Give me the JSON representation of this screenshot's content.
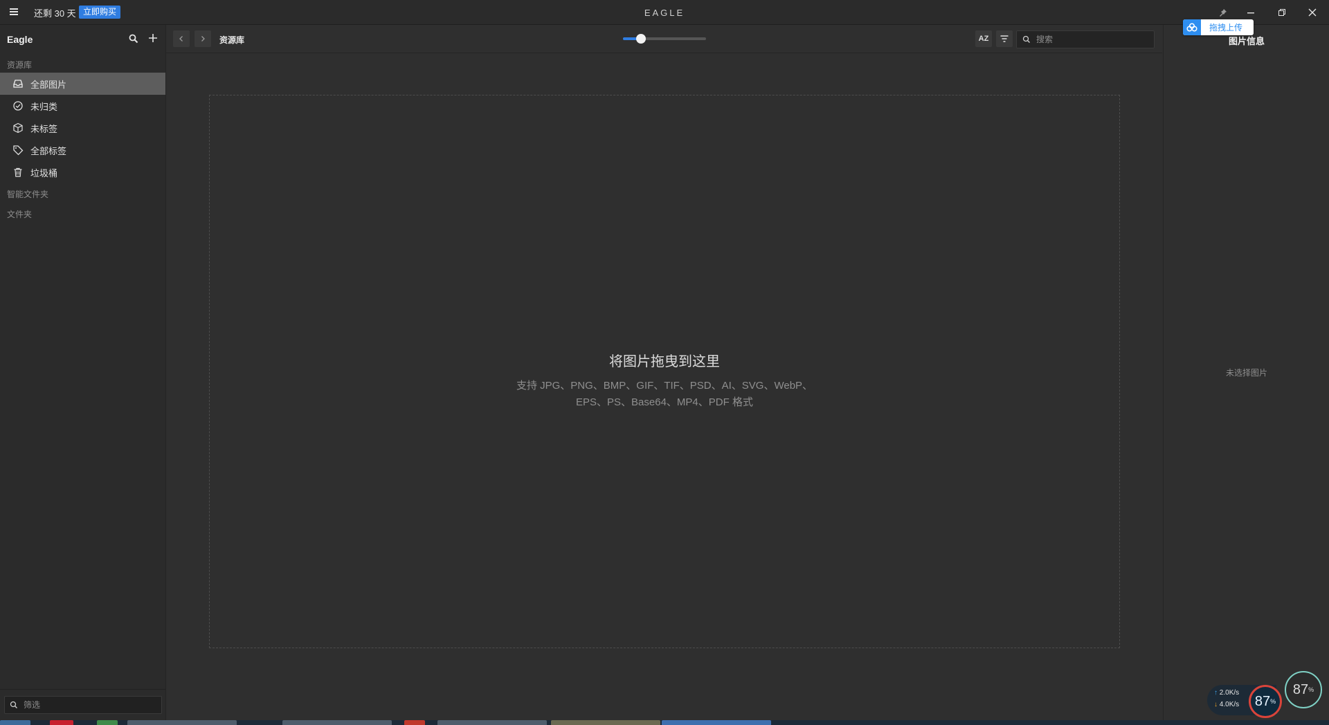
{
  "titlebar": {
    "trial_text": "还剩 30 天",
    "buy_label": "立即购买",
    "app_name": "EAGLE"
  },
  "upload_widget": {
    "label": "拖拽上传"
  },
  "sidebar": {
    "title": "Eagle",
    "section_library": "资源库",
    "items": [
      {
        "label": "全部图片",
        "icon": "inbox-icon"
      },
      {
        "label": "未归类",
        "icon": "check-circle-icon"
      },
      {
        "label": "未标签",
        "icon": "box-icon"
      },
      {
        "label": "全部标签",
        "icon": "tag-icon"
      },
      {
        "label": "垃圾桶",
        "icon": "trash-icon"
      }
    ],
    "section_smart": "智能文件夹",
    "section_folders": "文件夹",
    "filter_placeholder": "筛选"
  },
  "toolbar": {
    "breadcrumb": "资源库",
    "zoom_level": 0.22,
    "sort_label": "AZ",
    "search_placeholder": "搜索"
  },
  "main": {
    "drop_title": "将图片拖曳到这里",
    "drop_line1": "支持 JPG、PNG、BMP、GIF、TIF、PSD、AI、SVG、WebP、",
    "drop_line2": "EPS、PS、Base64、MP4、PDF 格式"
  },
  "right_panel": {
    "title": "图片信息",
    "empty_text": "未选择图片"
  },
  "net_widget": {
    "upload_rate": "2.0",
    "download_rate": "4.0",
    "rate_unit": "K/s",
    "gauge1_value": "87",
    "gauge2_value": "87",
    "percent_sign": "%"
  },
  "colors": {
    "accent": "#2f7de1",
    "background": "#2f2f2f",
    "sidebar": "#2b2b2b",
    "active_item": "#5d5d5d"
  }
}
